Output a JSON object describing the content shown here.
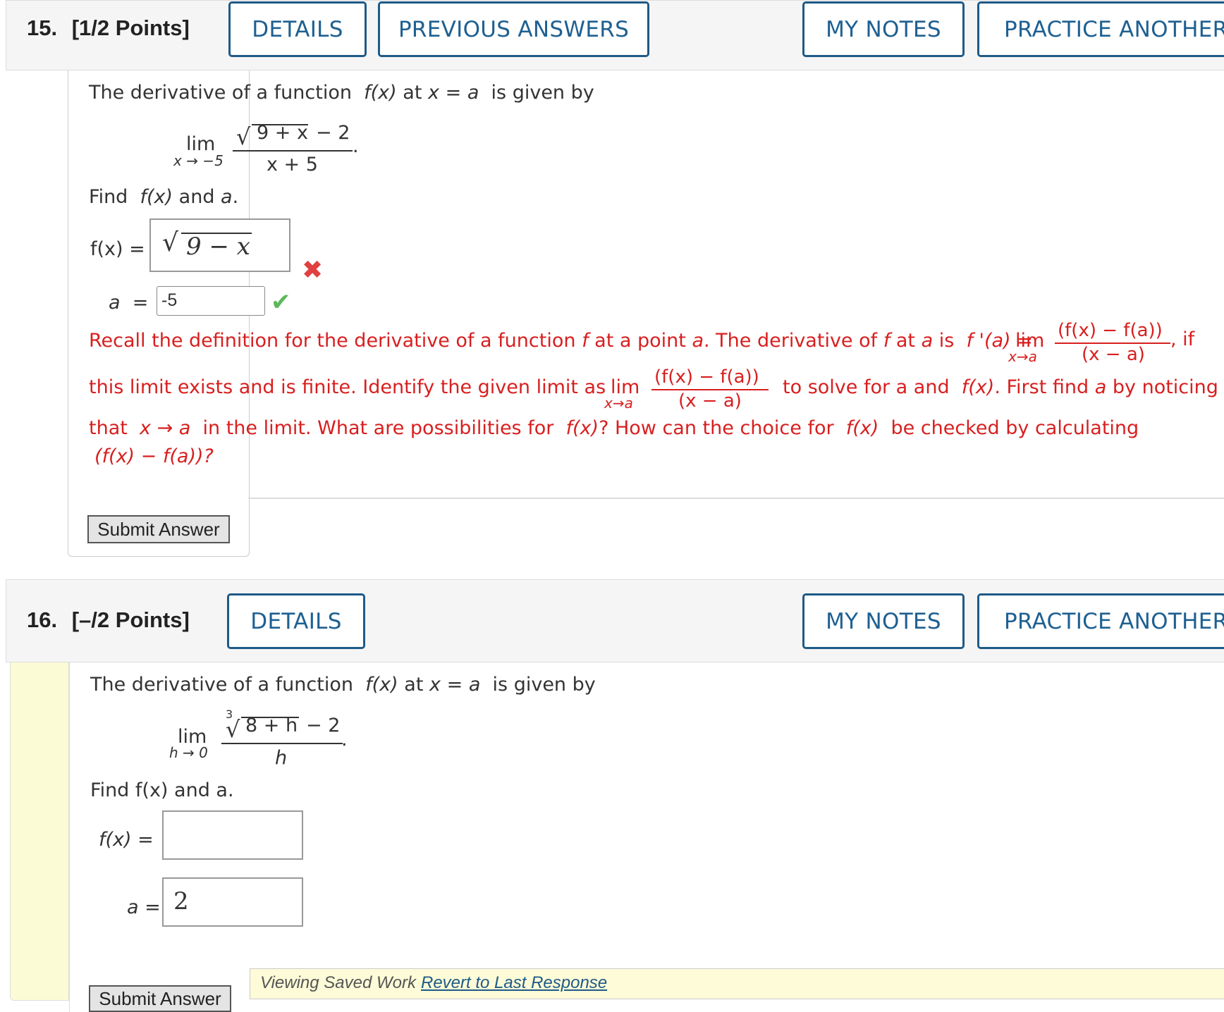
{
  "q15": {
    "number": "15.",
    "points": "[1/2 Points]",
    "buttons": {
      "details": "DETAILS",
      "previous": "PREVIOUS ANSWERS",
      "notes": "MY NOTES",
      "practice": "PRACTICE ANOTHER"
    },
    "intro": {
      "a": "The derivative of a function",
      "fx": "f(x)",
      "at": "at",
      "x": "x",
      "eq": "=",
      "aa": "a",
      "given": "is given by"
    },
    "limit": {
      "lim": "lim",
      "sub": "x → −5",
      "num_inner": "9 + x",
      "num_tail": "− 2",
      "den": "x + 5",
      "dot": "."
    },
    "find": {
      "prefix": "Find",
      "fx": "f(x)",
      "and": "and",
      "a": "a",
      "dot": "."
    },
    "fx_label": "f(x) =",
    "fx_answer_inner": "9 − x",
    "a_label": "a  =",
    "a_answer": "-5",
    "feedback": {
      "l1a": "Recall the definition for the derivative of a function",
      "l1f": "f",
      "l1b": "at a point",
      "l1a2": "a",
      "l1c": ". The derivative of",
      "l1f2": "f",
      "l1d": "at",
      "l1a3": "a",
      "l1e": "is",
      "l1fp": "f '(a)",
      "l1eq": "=",
      "lim": "lim",
      "lim_sub": "x→a",
      "num": "(f(x) − f(a))",
      "den": "(x − a)",
      "l1g": ", if",
      "l2a": "this limit exists and is finite. Identify the given limit as",
      "l2b": "to solve for a and",
      "l2fx": "f(x)",
      "l2c": ". First find",
      "l2a2": "a",
      "l2d": "by noticing",
      "l3a": "that",
      "l3arrow": "x → a",
      "l3b": "in the limit. What are possibilities for",
      "l3fx": "f(x)",
      "l3c": "? How can the choice for",
      "l3fx2": "f(x)",
      "l3d": "be checked by calculating",
      "l4": "(f(x) − f(a))?"
    },
    "submit": "Submit Answer"
  },
  "q16": {
    "number": "16.",
    "points": "[–/2 Points]",
    "buttons": {
      "details": "DETAILS",
      "notes": "MY NOTES",
      "practice": "PRACTICE ANOTHER"
    },
    "intro": {
      "a": "The derivative of a function",
      "fx": "f(x)",
      "at": "at",
      "x": "x",
      "eq": "=",
      "aa": "a",
      "given": "is given by"
    },
    "limit": {
      "lim": "lim",
      "sub": "h → 0",
      "index": "3",
      "num_inner": "8 + h",
      "num_tail": "− 2",
      "den": "h",
      "dot": "."
    },
    "find": "Find f(x) and a.",
    "fx_label": "f(x)  =",
    "fx_answer": "",
    "a_label": "a =",
    "a_answer": "2",
    "saved": {
      "text": "Viewing Saved Work",
      "link": "Revert to Last Response"
    },
    "submit": "Submit Answer"
  },
  "colors": {
    "accent": "#1e5a87",
    "error": "#d81f1f",
    "saved_bg": "#fdfbd8",
    "panel_left": "#fbfbd5"
  }
}
